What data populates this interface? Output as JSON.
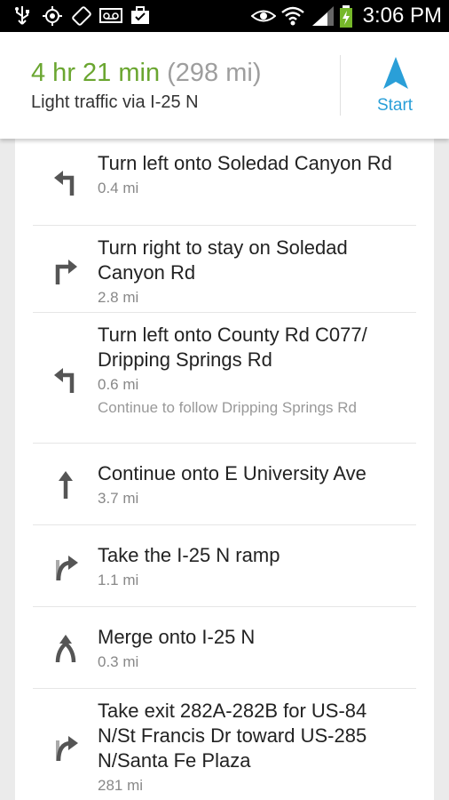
{
  "status_bar": {
    "time": "3:06 PM",
    "icons_left": [
      "usb-icon",
      "gps-icon",
      "rotation-icon",
      "voicemail-icon",
      "briefcase-icon"
    ],
    "icons_right": [
      "privacy-icon",
      "wifi-icon",
      "signal-icon",
      "battery-charging-icon"
    ]
  },
  "summary": {
    "duration": "4 hr 21 min",
    "distance": "(298 mi)",
    "route": "Light traffic via I-25 N",
    "start_label": "Start"
  },
  "steps": [
    {
      "icon": "turn-left-icon",
      "instruction": "Turn left onto Soledad Canyon Rd",
      "distance": "0.4 mi"
    },
    {
      "icon": "turn-right-icon",
      "instruction": "Turn right to stay on Soledad Canyon Rd",
      "distance": "2.8 mi"
    },
    {
      "icon": "turn-left-icon",
      "instruction": "Turn left onto County Rd C077/ Dripping Springs Rd",
      "distance": "0.6 mi",
      "note": "Continue to follow Dripping Springs Rd"
    },
    {
      "icon": "straight-icon",
      "instruction": "Continue onto E University Ave",
      "distance": "3.7 mi"
    },
    {
      "icon": "ramp-right-icon",
      "instruction": "Take the I-25 N ramp",
      "distance": "1.1 mi"
    },
    {
      "icon": "merge-icon",
      "instruction": "Merge onto I-25 N",
      "distance": "0.3 mi"
    },
    {
      "icon": "ramp-right-icon",
      "instruction": "Take exit 282A-282B for US-84 N/St Francis Dr toward US-285 N/Santa Fe Plaza",
      "distance": "281 mi"
    }
  ],
  "colors": {
    "duration_green": "#6aa630",
    "start_blue": "#2a9fd8",
    "icon_gray": "#555555"
  }
}
